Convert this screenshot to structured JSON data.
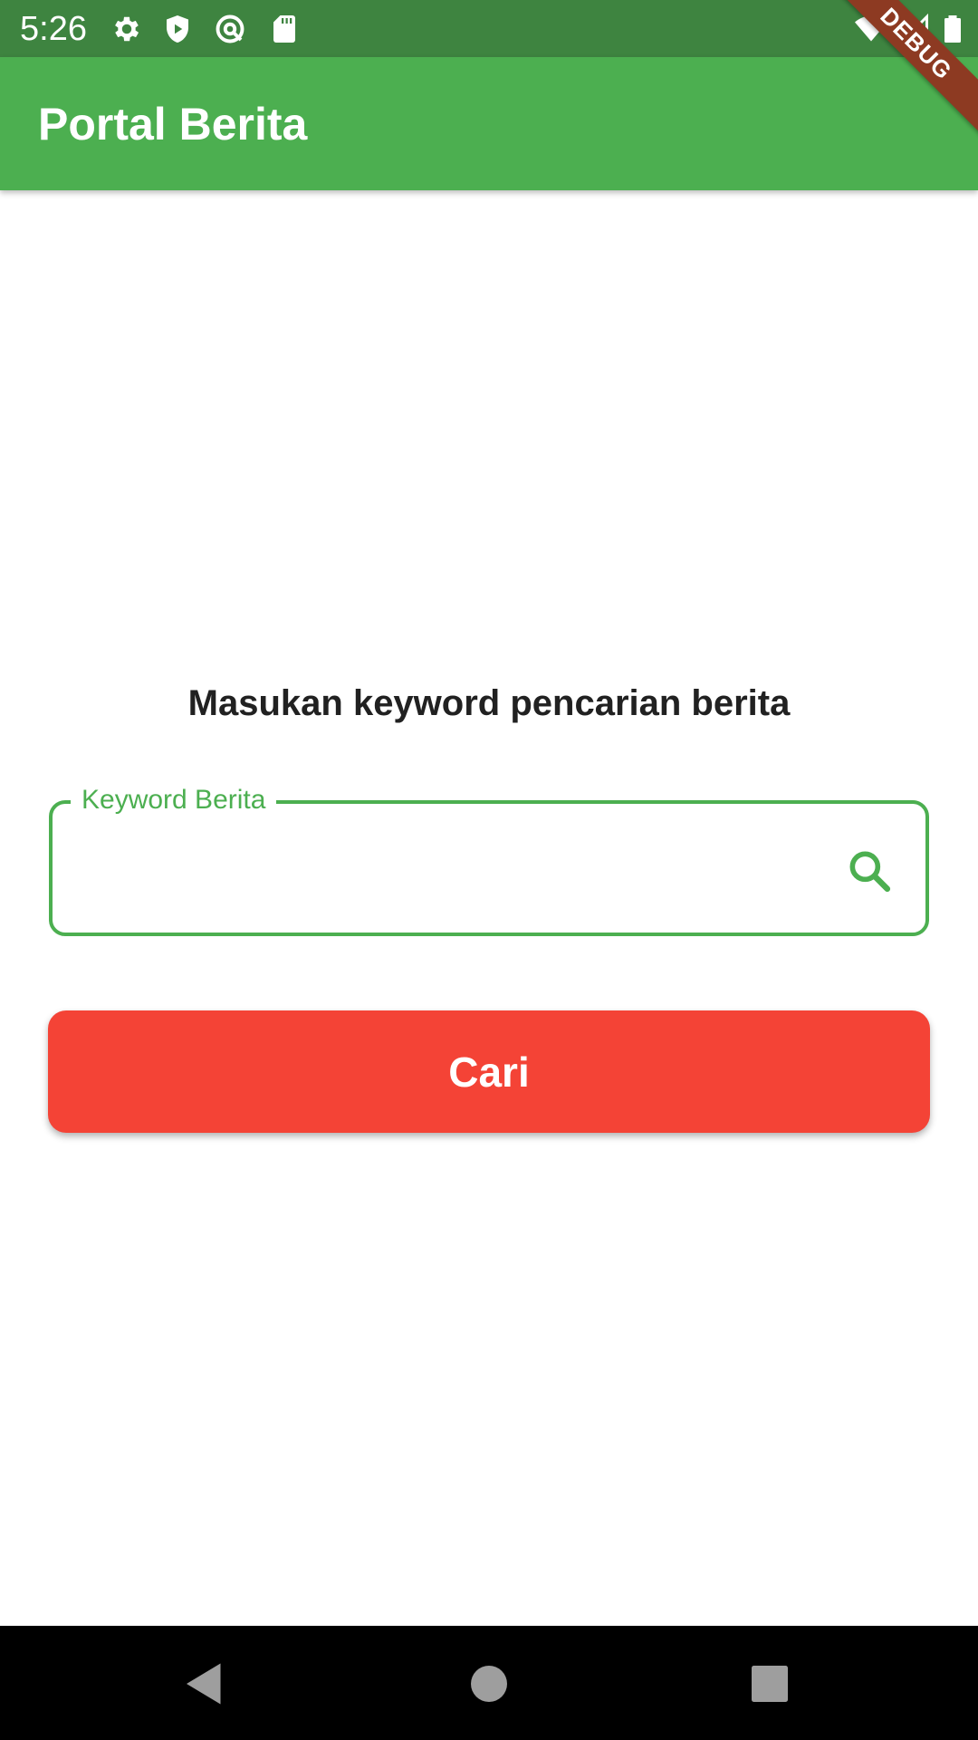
{
  "status_bar": {
    "time": "5:26",
    "icons": [
      "gear-icon",
      "shield-play-icon",
      "at-sign-icon",
      "sd-card-icon",
      "wifi-icon",
      "signal-icon",
      "battery-icon"
    ]
  },
  "app_bar": {
    "title": "Portal Berita"
  },
  "debug_banner": {
    "label": "DEBUG"
  },
  "main": {
    "prompt": "Masukan keyword pencarian berita",
    "search_field": {
      "label": "Keyword Berita",
      "value": ""
    },
    "search_button_label": "Cari"
  },
  "nav_bar": {
    "buttons": [
      "back-icon",
      "home-icon",
      "recents-icon"
    ]
  },
  "colors": {
    "status_bar": "#3e8440",
    "app_bar": "#4caf50",
    "accent": "#4caf50",
    "button": "#f44336",
    "debug_banner": "#8d3a22"
  }
}
